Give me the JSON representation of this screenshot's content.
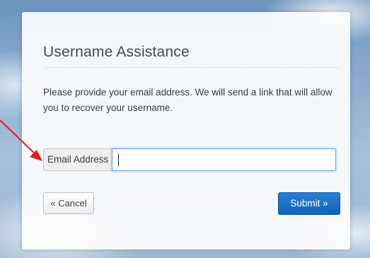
{
  "dialog": {
    "title": "Username Assistance",
    "description": "Please provide your email address. We will send a link that will allow you to recover your username."
  },
  "form": {
    "email_label": "Email Address",
    "email_value": "",
    "email_placeholder": ""
  },
  "buttons": {
    "cancel_label": "« Cancel",
    "submit_label": "Submit »"
  },
  "annotation": {
    "arrow_color": "#e0201b"
  },
  "colors": {
    "primary_button": "#1a6fc4",
    "focus_border": "#6aa0dc"
  }
}
